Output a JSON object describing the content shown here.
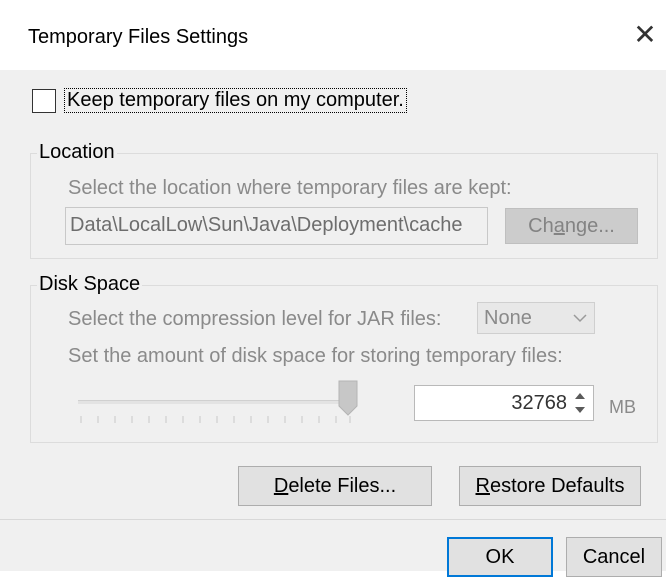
{
  "dialog": {
    "title": "Temporary Files Settings",
    "close_glyph": "✕"
  },
  "keep_files": {
    "label": "Keep temporary files on my computer.",
    "checked": false
  },
  "location": {
    "legend": "Location",
    "description": "Select the location where temporary files are kept:",
    "path_value": "Data\\LocalLow\\Sun\\Java\\Deployment\\cache",
    "change_button": {
      "pre": "Ch",
      "accel": "a",
      "post": "nge..."
    }
  },
  "disk_space": {
    "legend": "Disk Space",
    "compression_label": "Select the compression level for JAR files:",
    "compression_value": "None",
    "amount_label": "Set the amount of disk space for storing temporary files:",
    "slider_level": 1.0,
    "spinner_value": "32768",
    "unit": "MB"
  },
  "buttons": {
    "delete": {
      "accel": "D",
      "post": "elete Files..."
    },
    "restore": {
      "accel": "R",
      "post": "estore Defaults"
    },
    "ok": "OK",
    "cancel": "Cancel"
  },
  "icons": {
    "close": "close-icon",
    "chevron": "chevron-down-icon",
    "spin_up": "spinner-up-icon",
    "spin_down": "spinner-down-icon"
  },
  "colors": {
    "accent": "#0078d7",
    "dialog_bg": "#f0f0f0",
    "disabled_text": "#8a8a8a"
  }
}
